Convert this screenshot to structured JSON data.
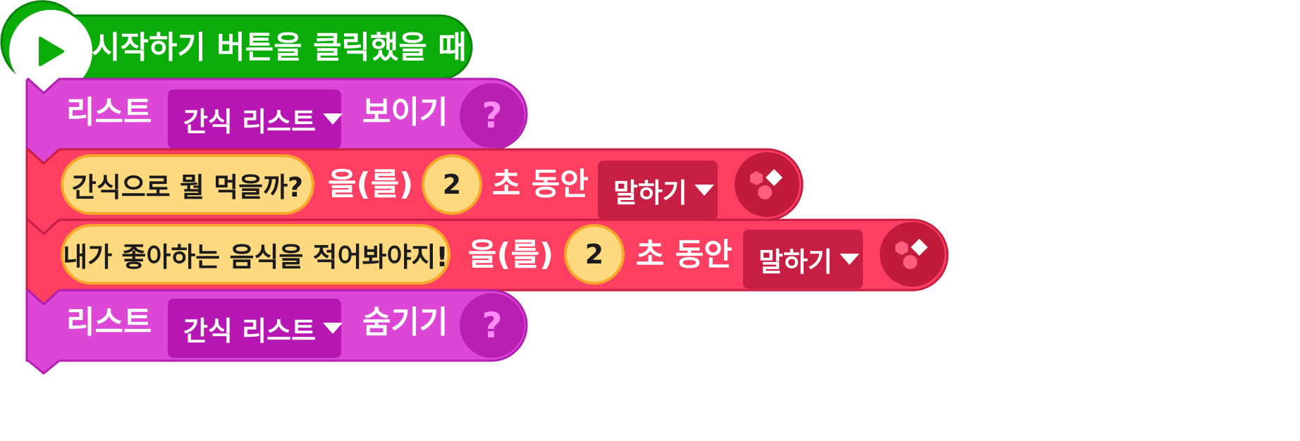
{
  "colors": {
    "start_green": "#0aad07",
    "start_green_border": "#08840a",
    "list_purple": "#dd47d6",
    "list_purple_border": "#b01fb0",
    "speech_red": "#ff3f62",
    "speech_red_border": "#c71e43",
    "value_yellow": "#fdd97f",
    "value_yellow_border": "#f9a82b"
  },
  "start_block": {
    "label": "시작하기 버튼을 클릭했을 때",
    "icon": "play-icon"
  },
  "show_list_block": {
    "prefix": "리스트",
    "dropdown_value": "간식 리스트",
    "action": "보이기",
    "help_icon": "question-mark-icon",
    "help_symbol": "?"
  },
  "say_block_1": {
    "message": "간식으로 뭘 먹을까?",
    "particle": "을(를)",
    "seconds": "2",
    "unit": "초 동안",
    "mode_value": "말하기",
    "icon": "shapes-icon"
  },
  "say_block_2": {
    "message": "내가 좋아하는 음식을 적어봐야지!",
    "particle": "을(를)",
    "seconds": "2",
    "unit": "초 동안",
    "mode_value": "말하기",
    "icon": "shapes-icon"
  },
  "hide_list_block": {
    "prefix": "리스트",
    "dropdown_value": "간식 리스트",
    "action": "숨기기",
    "help_icon": "question-mark-icon",
    "help_symbol": "?"
  }
}
